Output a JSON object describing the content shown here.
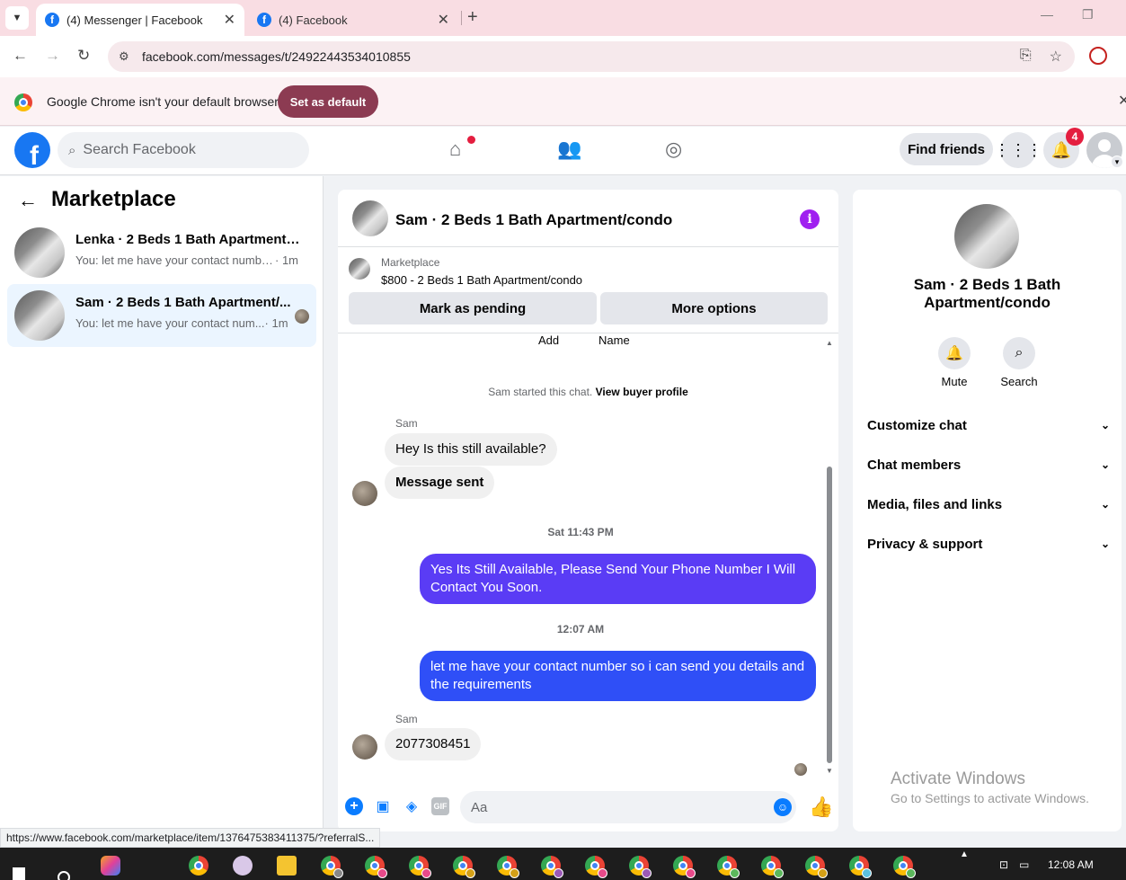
{
  "browser": {
    "tabs": [
      {
        "title": "(4) Messenger | Facebook",
        "active": true
      },
      {
        "title": "(4) Facebook",
        "active": false
      }
    ],
    "url": "facebook.com/messages/t/24922443534010855",
    "infobar": {
      "text": "Google Chrome isn't your default browser",
      "button": "Set as default"
    },
    "status_url": "https://www.facebook.com/marketplace/item/1376475383411375/?referralS..."
  },
  "fb_header": {
    "search_placeholder": "Search Facebook",
    "find_friends": "Find friends",
    "notification_count": "4"
  },
  "left_panel": {
    "title": "Marketplace",
    "conversations": [
      {
        "name": "Lenka · 2 Beds 1 Bath Apartment/c...",
        "preview": "You: let me have your contact numbe...",
        "time": "· 1m",
        "selected": false
      },
      {
        "name": "Sam · 2 Beds 1 Bath Apartment/...",
        "preview": "You: let me have your contact num...",
        "time": "· 1m",
        "selected": true
      }
    ]
  },
  "chat": {
    "title": "Sam · 2 Beds 1 Bath Apartment/condo",
    "marketplace_label": "Marketplace",
    "listing": "$800 - 2 Beds 1 Bath Apartment/condo",
    "mark_pending": "Mark as pending",
    "more_options": "More options",
    "cut_add": "Add",
    "cut_name": "Name",
    "system_text": "Sam started this chat.",
    "system_link": "View buyer profile",
    "sender1": "Sam",
    "msg_in1": "Hey Is this still available?",
    "msg_in2": "Message sent",
    "ts1": "Sat 11:43 PM",
    "msg_out1": "Yes Its Still Available, Please Send Your Phone Number I Will Contact You Soon.",
    "ts2": "12:07 AM",
    "msg_out2": "let me have your contact number so i can send you details and the requirements",
    "sender2": "Sam",
    "msg_in3": "2077308451",
    "composer_placeholder": "Aa",
    "out_colors": [
      "#5a3cf5",
      "#2f4ff7"
    ]
  },
  "right_panel": {
    "name": "Sam · 2 Beds 1 Bath Apartment/condo",
    "actions": [
      {
        "label": "Mute",
        "icon": "bell-icon"
      },
      {
        "label": "Search",
        "icon": "search-icon"
      }
    ],
    "sections": [
      "Customize chat",
      "Chat members",
      "Media, files and links",
      "Privacy & support"
    ]
  },
  "watermark": {
    "line1": "Activate Windows",
    "line2": "Go to Settings to activate Windows."
  },
  "taskbar": {
    "time": "12:08 AM"
  }
}
